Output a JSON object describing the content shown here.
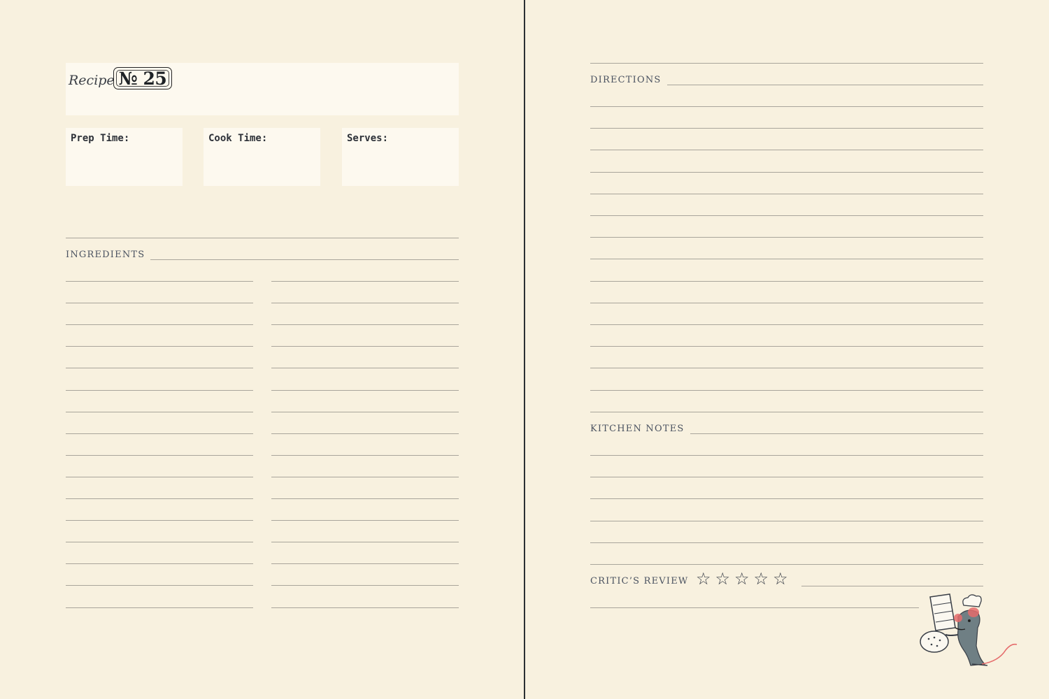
{
  "recipe": {
    "label": "Recipe",
    "number": "№ 25"
  },
  "info_fields": {
    "prep_time": "Prep Time:",
    "cook_time": "Cook Time:",
    "serves": "Serves:"
  },
  "sections": {
    "ingredients": "INGREDIENTS",
    "directions": "DIRECTIONS",
    "kitchen_notes": "KITCHEN NOTES",
    "critics_review": "CRITIC’S REVIEW"
  },
  "review": {
    "stars_total": 5,
    "stars_filled": 0,
    "star_glyph": "☆"
  },
  "illustration": {
    "icon": "chef-rat-with-salt-shaker-icon"
  },
  "colors": {
    "paper": "#f8f1df",
    "box": "#fdf9ef",
    "rule": "#a9a59b",
    "ink": "#3f4650",
    "spine": "#2b2f33"
  }
}
